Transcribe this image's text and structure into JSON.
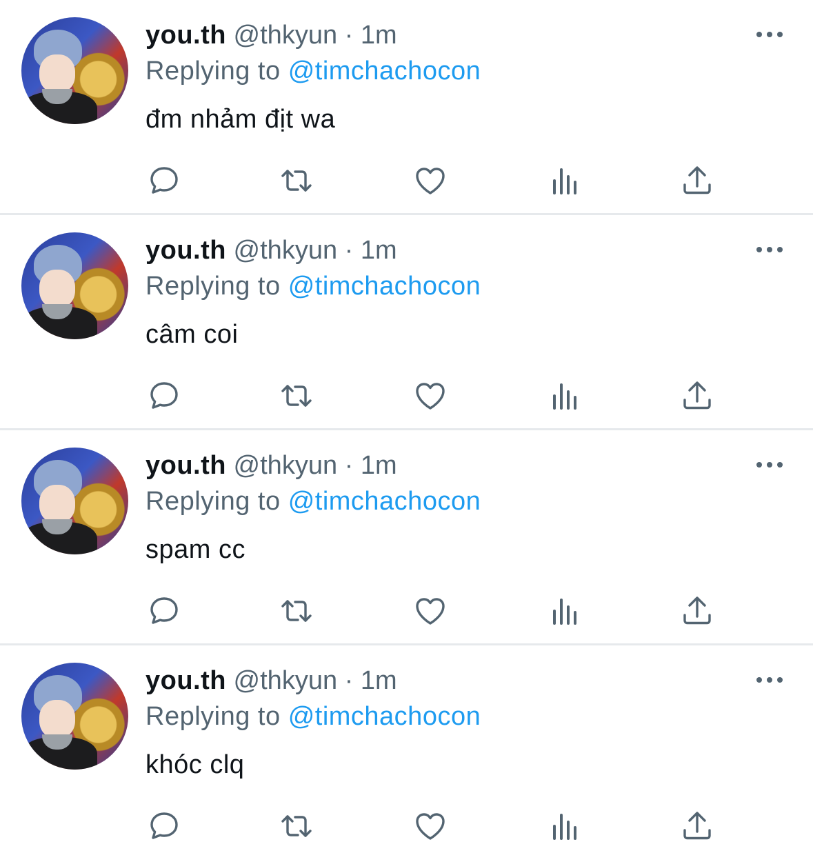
{
  "colors": {
    "text": "#0f1419",
    "secondary": "#536471",
    "link": "#1d9bf0",
    "divider": "#e6e9ec"
  },
  "icons": [
    "avatar",
    "more-icon",
    "reply-icon",
    "retweet-icon",
    "like-icon",
    "views-icon",
    "share-icon"
  ],
  "tweets": [
    {
      "name": "you.th",
      "handle": "@thkyun",
      "separator": "·",
      "time": "1m",
      "replying_prefix": "Replying to",
      "replying_to": "@timchachocon",
      "text": "đm nhảm địt wa"
    },
    {
      "name": "you.th",
      "handle": "@thkyun",
      "separator": "·",
      "time": "1m",
      "replying_prefix": "Replying to",
      "replying_to": "@timchachocon",
      "text": "câm coi"
    },
    {
      "name": "you.th",
      "handle": "@thkyun",
      "separator": "·",
      "time": "1m",
      "replying_prefix": "Replying to",
      "replying_to": "@timchachocon",
      "text": "spam cc"
    },
    {
      "name": "you.th",
      "handle": "@thkyun",
      "separator": "·",
      "time": "1m",
      "replying_prefix": "Replying to",
      "replying_to": "@timchachocon",
      "text": "khóc clq"
    }
  ]
}
